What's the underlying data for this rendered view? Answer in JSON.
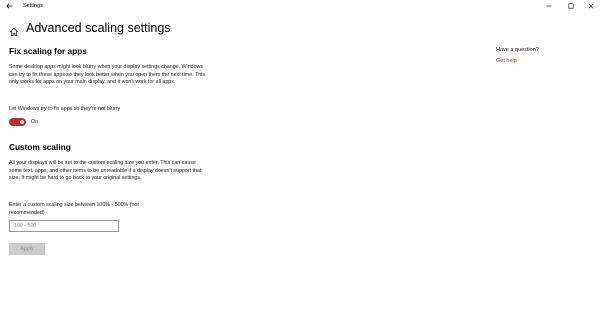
{
  "window": {
    "app_title": "Settings",
    "back_icon": "arrow-left-icon",
    "minimize_icon": "minimize-icon",
    "maximize_icon": "maximize-icon",
    "close_icon": "close-icon"
  },
  "header": {
    "home_icon": "home-icon",
    "title": "Advanced scaling settings"
  },
  "fix_scaling": {
    "title": "Fix scaling for apps",
    "description": "Some desktop apps might look blurry when your display settings change. Windows can try to fix these apps so they look better when you open them the next time. This only works for apps on your main display, and it won't work for all apps.",
    "toggle_label": "Let Windows try to fix apps so they're not blurry",
    "toggle_on": true,
    "toggle_state_text": "On"
  },
  "custom_scaling": {
    "title": "Custom scaling",
    "description": "All your displays will be set to the custom scaling size you enter. This can cause some text, apps, and other items to be unreadable if a display doesn't support that size. It might be hard to go back to your original settings.",
    "input_label": "Enter a custom scaling size between 100% - 500% (not recommended)",
    "input_value": "",
    "input_placeholder": "100 - 500",
    "apply_label": "Apply",
    "apply_enabled": false
  },
  "sidebar": {
    "question": "Have a question?",
    "help_link": "Get help"
  },
  "colors": {
    "accent": "#c3282f",
    "disabled_button_bg": "#cccccc",
    "disabled_button_text": "#8f8f8f"
  }
}
